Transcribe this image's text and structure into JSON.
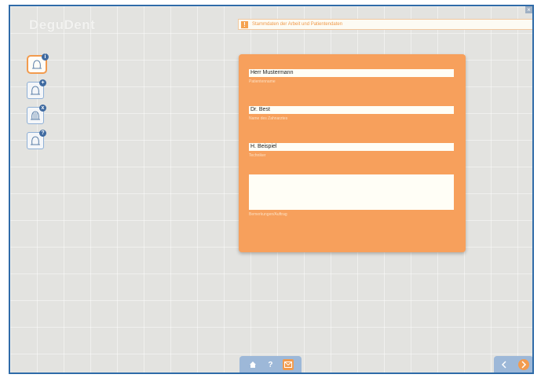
{
  "app": {
    "title": "DeguDent"
  },
  "hint": {
    "icon": "info-icon",
    "text": "Stammdaten der Arbeit und Patientendaten"
  },
  "tools": [
    {
      "name": "crown-info-icon",
      "badge": "i",
      "active": true
    },
    {
      "name": "crown-add-icon",
      "badge": "+",
      "active": false
    },
    {
      "name": "bridge-icon",
      "badge": "x",
      "active": false
    },
    {
      "name": "crown-edit-icon",
      "badge": "?",
      "active": false
    }
  ],
  "form": {
    "patient": {
      "value": "Herr Mustermann",
      "label": "Patientenname"
    },
    "dentist": {
      "value": "Dr. Best",
      "label": "Name des Zahnarztes"
    },
    "technician": {
      "value": "H. Beispiel",
      "label": "Techniker"
    },
    "notes": {
      "value": "",
      "label": "Bemerkungen/Auftrag"
    }
  },
  "bottom_bar": {
    "help_label": "?"
  },
  "colors": {
    "accent": "#f7a05c",
    "frame": "#2f6ba8",
    "toolbar": "#9db8d8"
  }
}
